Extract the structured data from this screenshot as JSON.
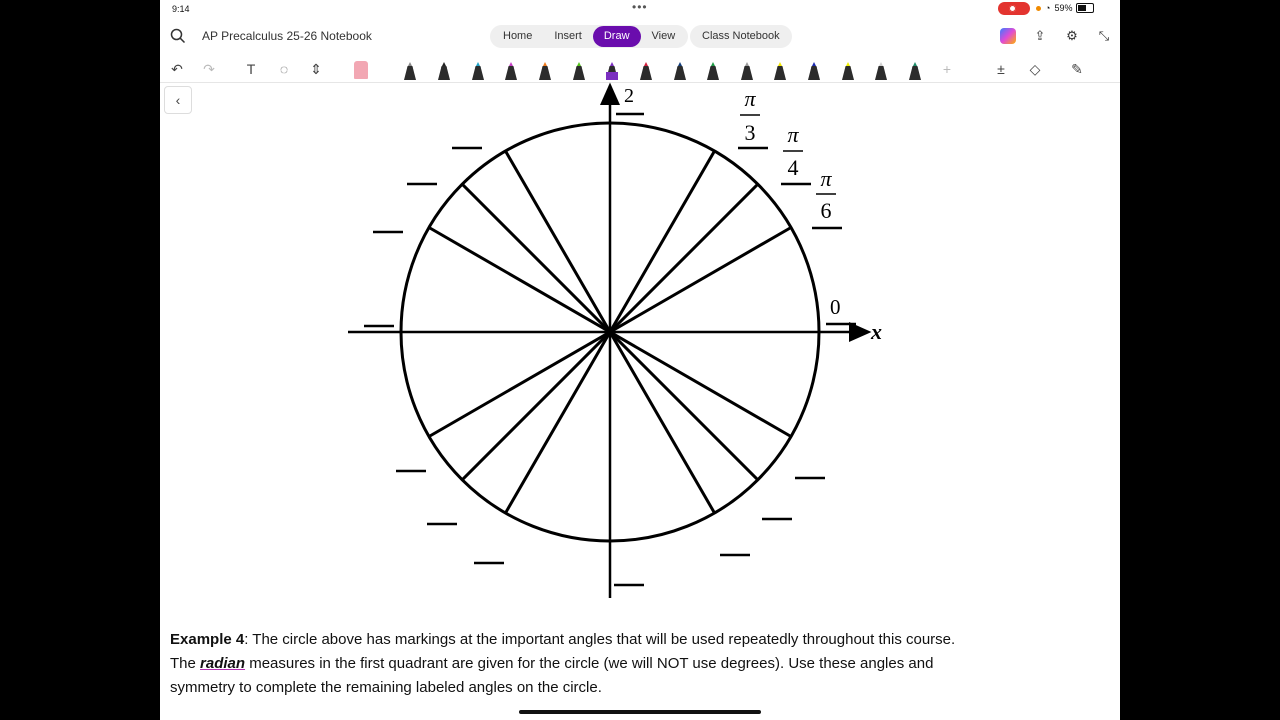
{
  "status": {
    "time": "9:14",
    "battery": "59%"
  },
  "header": {
    "notebook_title": "AP Precalculus 25-26 Notebook",
    "tabs": [
      {
        "label": "Home"
      },
      {
        "label": "Insert"
      },
      {
        "label": "Draw",
        "active": true
      },
      {
        "label": "View"
      }
    ],
    "class_notebook_label": "Class Notebook"
  },
  "toolbar": {
    "pen_colors": [
      "#8a8a8a",
      "#222222",
      "#1fa3c8",
      "#c640c6",
      "#f07a1a",
      "#52c41a",
      "#7b2fc0",
      "#d21f3c",
      "#123c7a",
      "#1e9a46",
      "#9a9a9a",
      "#f2e600",
      "#1a2ab0",
      "#f0f000",
      "#cfcfcf",
      "#1e8c6a"
    ]
  },
  "diagram": {
    "y_top_label": "2",
    "pi_symbol": "π",
    "labels": [
      {
        "numerator": "π",
        "denominator": "3"
      },
      {
        "numerator": "π",
        "denominator": "4"
      },
      {
        "numerator": "π",
        "denominator": "6"
      }
    ],
    "zero_label": "0",
    "x_axis_label": "x"
  },
  "caption": {
    "example_label": "Example 4",
    "line1_rest": ":  The circle above has markings at the important angles that will be used repeatedly throughout this course.",
    "line2_prefix": "The ",
    "radian_word": "radian",
    "line2_rest": " measures in the first quadrant are given for the circle (we will NOT use degrees).  Use these angles and",
    "line3": "symmetry to complete the remaining labeled angles on the circle."
  }
}
